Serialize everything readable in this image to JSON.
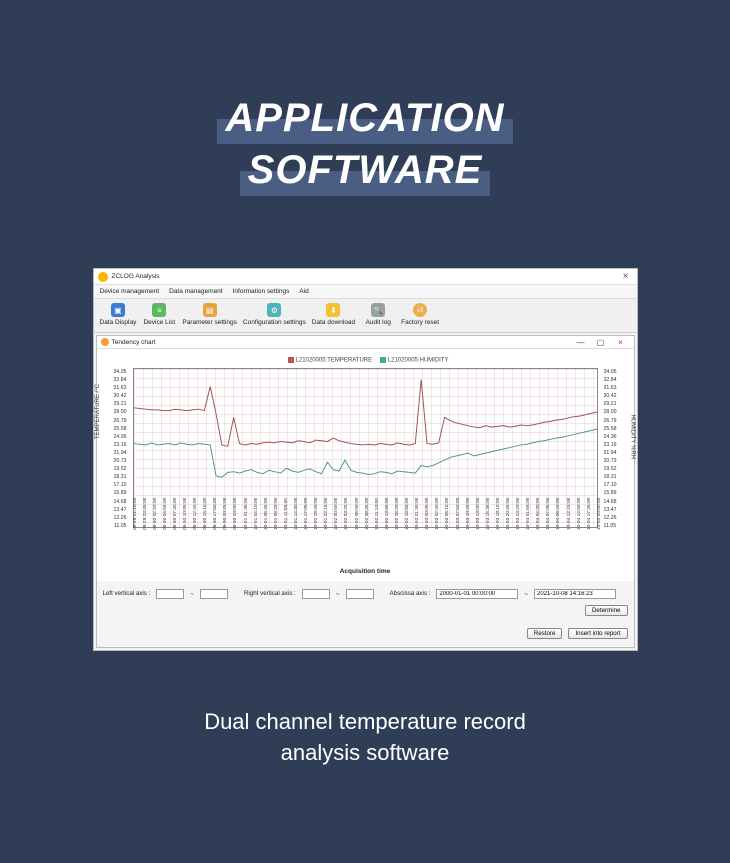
{
  "hero": {
    "line1": "APPLICATION",
    "line2": "SOFTWARE"
  },
  "app": {
    "title": "ZCLOG Analysis",
    "close_glyph": "×"
  },
  "menubar": [
    "Device management",
    "Data management",
    "Information settings",
    "Aid"
  ],
  "toolbar": [
    {
      "label": "Data Display"
    },
    {
      "label": "Device List"
    },
    {
      "label": "Parameter settings"
    },
    {
      "label": "Configuration settings"
    },
    {
      "label": "Data download"
    },
    {
      "label": "Audit log"
    },
    {
      "label": "Factory reset"
    }
  ],
  "child": {
    "title": "Tendency chart",
    "min": "—",
    "max": "▢",
    "close": "×"
  },
  "chart_data": {
    "type": "line",
    "title_left_axis": "TEMPERATURE /°C",
    "title_right_axis": "HUMIDITY %RH",
    "xlabel": "Acquisition time",
    "legend": [
      {
        "name": "L21020005:TEMPERATURE"
      },
      {
        "name": "L21020005:HUMIDITY"
      }
    ],
    "y_left_ticks": [
      "34.05",
      "32.84",
      "31.63",
      "30.42",
      "29.21",
      "28.00",
      "26.79",
      "25.58",
      "24.36",
      "23.16",
      "21.94",
      "20.73",
      "19.52",
      "18.31",
      "17.10",
      "15.89",
      "14.68",
      "13.47",
      "12.26",
      "11.05"
    ],
    "y_right_ticks": [
      "34.05",
      "32.84",
      "31.63",
      "30.42",
      "29.21",
      "28.00",
      "26.79",
      "25.58",
      "24.36",
      "23.16",
      "21.94",
      "20.73",
      "19.52",
      "18.31",
      "17.10",
      "15.89",
      "14.68",
      "13.47",
      "12.26",
      "11.05"
    ],
    "ylim": [
      11.05,
      34.05
    ],
    "x_ticks": [
      "09-29 21:10:00",
      "09-29 23:45:00",
      "09-30 02:20:00",
      "09-30 04:55:00",
      "09-30 07:30:00",
      "09-30 10:05:00",
      "09-30 12:40:00",
      "09-30 15:15:00",
      "09-30 17:50:00",
      "09-30 20:25:00",
      "09-30 23:00:00",
      "10-01 01:35:00",
      "10-01 04:10:00",
      "10-01 06:45:00",
      "10-01 09:20:00",
      "10-01 11:55:00",
      "10-01 14:30:00",
      "10-01 17:05:00",
      "10-01 19:40:00",
      "10-01 22:15:00",
      "10-02 00:50:00",
      "10-02 03:25:00",
      "10-02 06:00:00",
      "10-02 08:35:00",
      "10-02 11:10:00",
      "10-02 13:45:00",
      "10-02 16:20:00",
      "10-02 18:55:00",
      "10-02 21:30:00",
      "10-03 00:05:00",
      "10-03 02:40:00",
      "10-03 05:15:00",
      "10-03 07:50:00",
      "10-03 10:25:00",
      "10-03 13:00:00",
      "10-03 15:35:00",
      "10-03 18:10:00",
      "10-03 20:45:00",
      "10-03 23:20:00",
      "10-04 01:55:00",
      "10-04 04:30:00",
      "10-04 07:05:00",
      "10-04 09:40:00",
      "10-04 12:15:00",
      "10-04 14:50:00",
      "10-04 17:25:00",
      "10-04 20:00:00"
    ],
    "series": [
      {
        "name": "TEMPERATURE",
        "color": "#a05050",
        "values": [
          28.4,
          28.3,
          28.2,
          28.1,
          28.1,
          28.0,
          28.0,
          28.2,
          28.1,
          28.0,
          28.1,
          28.2,
          28.0,
          31.5,
          27.5,
          23.0,
          22.8,
          27.0,
          23.2,
          23.0,
          23.2,
          23.1,
          23.3,
          23.4,
          23.3,
          23.5,
          23.4,
          23.3,
          23.6,
          23.5,
          23.3,
          23.7,
          23.6,
          23.5,
          24.0,
          23.6,
          23.4,
          23.2,
          23.1,
          23.0,
          23.1,
          23.0,
          23.2,
          23.1,
          23.0,
          23.3,
          23.1,
          23.0,
          23.2,
          32.5,
          23.2,
          23.1,
          23.3,
          27.0,
          26.5,
          26.2,
          26.0,
          25.8,
          25.6,
          25.5,
          25.8,
          25.6,
          25.7,
          25.8,
          25.6,
          25.7,
          25.9,
          25.8,
          25.9,
          26.1,
          26.3,
          26.4,
          26.6,
          26.7,
          26.9,
          27.1,
          27.2,
          27.4,
          27.6,
          27.8
        ]
      },
      {
        "name": "HUMIDITY",
        "color": "#4a9a88",
        "values": [
          23.2,
          23.1,
          23.0,
          23.3,
          23.0,
          23.1,
          23.2,
          23.0,
          23.3,
          23.1,
          23.0,
          23.2,
          23.1,
          23.0,
          18.5,
          18.3,
          19.0,
          19.1,
          18.9,
          19.2,
          19.4,
          19.0,
          18.8,
          19.3,
          19.1,
          18.9,
          19.6,
          19.2,
          19.0,
          19.3,
          19.5,
          19.1,
          18.8,
          20.5,
          19.4,
          19.2,
          20.8,
          19.3,
          19.0,
          18.9,
          18.7,
          18.8,
          19.1,
          19.0,
          18.8,
          19.2,
          19.1,
          19.0,
          18.9,
          20.0,
          19.8,
          20.0,
          20.4,
          20.8,
          21.2,
          21.4,
          21.6,
          21.8,
          21.4,
          21.6,
          21.8,
          22.0,
          22.2,
          22.4,
          22.6,
          22.8,
          23.0,
          23.1,
          23.3,
          23.5,
          23.6,
          23.8,
          24.0,
          24.1,
          24.3,
          24.5,
          24.7,
          24.9,
          25.1,
          25.3
        ]
      }
    ]
  },
  "controls": {
    "left_vertical_axis_label": "Left vertical axis :",
    "right_vertical_axis_label": "Right vertical axis :",
    "abscissa_label": "Abscissa axis :",
    "tilde": "~",
    "left_min": "",
    "left_max": "",
    "right_min": "",
    "right_max": "",
    "abs_from": "2000-01-01 00:00:00",
    "abs_to": "2021-10-08 14:16:23",
    "determine": "Determine",
    "restore": "Restore",
    "insert": "Insert into report"
  },
  "caption": {
    "line1": "Dual channel temperature record",
    "line2": "analysis software"
  }
}
